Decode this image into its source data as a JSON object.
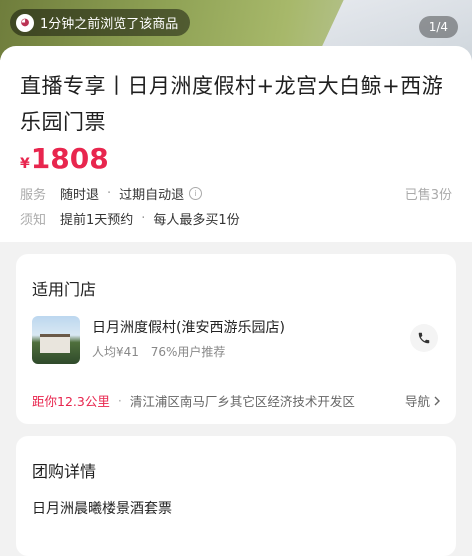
{
  "hero": {
    "visit_text": "1分钟之前浏览了该商品",
    "image_counter": "1/4"
  },
  "product": {
    "title": "直播专享丨日月洲度假村+龙宫大白鲸+西游乐园门票",
    "currency": "¥",
    "price": "1808",
    "service_label": "服务",
    "service_items": [
      "随时退",
      "过期自动退"
    ],
    "sold": "已售3份",
    "notice_label": "须知",
    "notice_items": [
      "提前1天预约",
      "每人最多买1份"
    ]
  },
  "store_section": {
    "heading": "适用门店",
    "store_name": "日月洲度假村(淮安西游乐园店)",
    "avg_price": "人均¥41",
    "recommend": "76%用户推荐",
    "distance": "距你12.3公里",
    "address": "清江浦区南马厂乡其它区经济技术开发区",
    "nav_label": "导航"
  },
  "detail_section": {
    "heading": "团购详情",
    "first_item": "日月洲晨曦楼景酒套票"
  },
  "colors": {
    "accent": "#e8264e",
    "muted": "#aaaaaa"
  }
}
